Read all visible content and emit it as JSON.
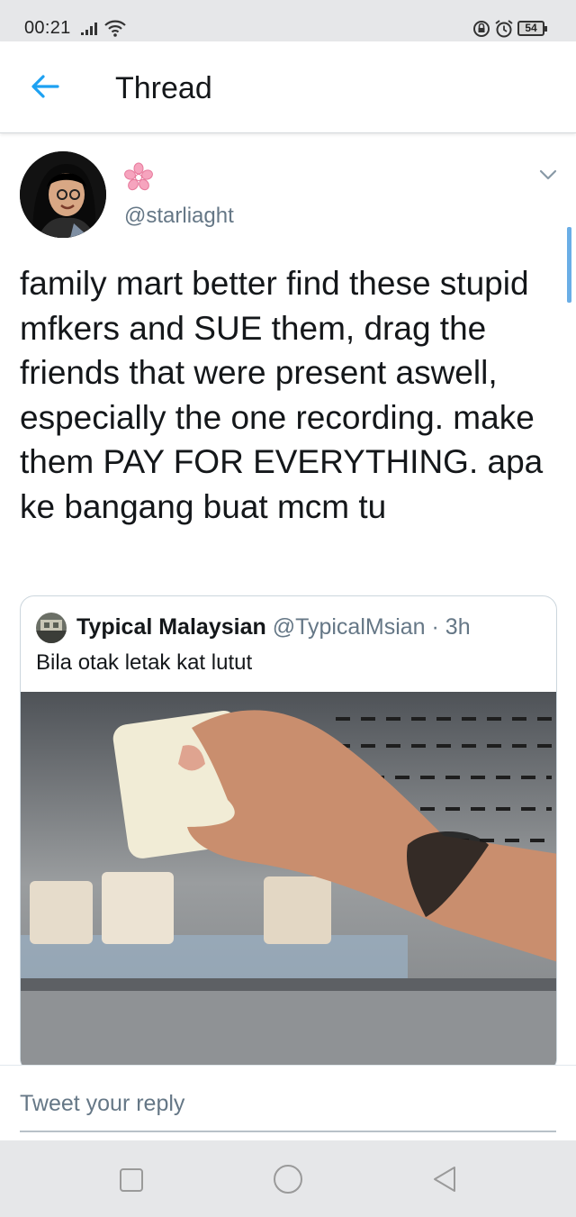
{
  "status_bar": {
    "time": "00:21",
    "battery": "54",
    "icons": [
      "signal-icon",
      "wifi-icon",
      "lock-rotation-icon",
      "alarm-icon",
      "battery-icon"
    ]
  },
  "header": {
    "title": "Thread",
    "back_icon": "arrow-left-icon",
    "accent_color": "#1da1f2"
  },
  "tweet": {
    "display_name_icon": "cherry-blossom-emoji",
    "handle": "@starliaght",
    "text": "family mart better find these stupid mfkers and SUE them, drag the friends that were present aswell, especially the one recording. make them PAY FOR EVERYTHING. apa ke bangang buat mcm tu",
    "menu_icon": "chevron-down-icon"
  },
  "quoted_tweet": {
    "name": "Typical Malaysian",
    "handle": "@TypicalMsian",
    "time": "· 3h",
    "text": "Bila otak letak kat lutut"
  },
  "reply": {
    "placeholder": "Tweet your reply"
  },
  "nav_bar": {
    "icons": [
      "recents-square-icon",
      "home-circle-icon",
      "back-triangle-icon"
    ]
  }
}
